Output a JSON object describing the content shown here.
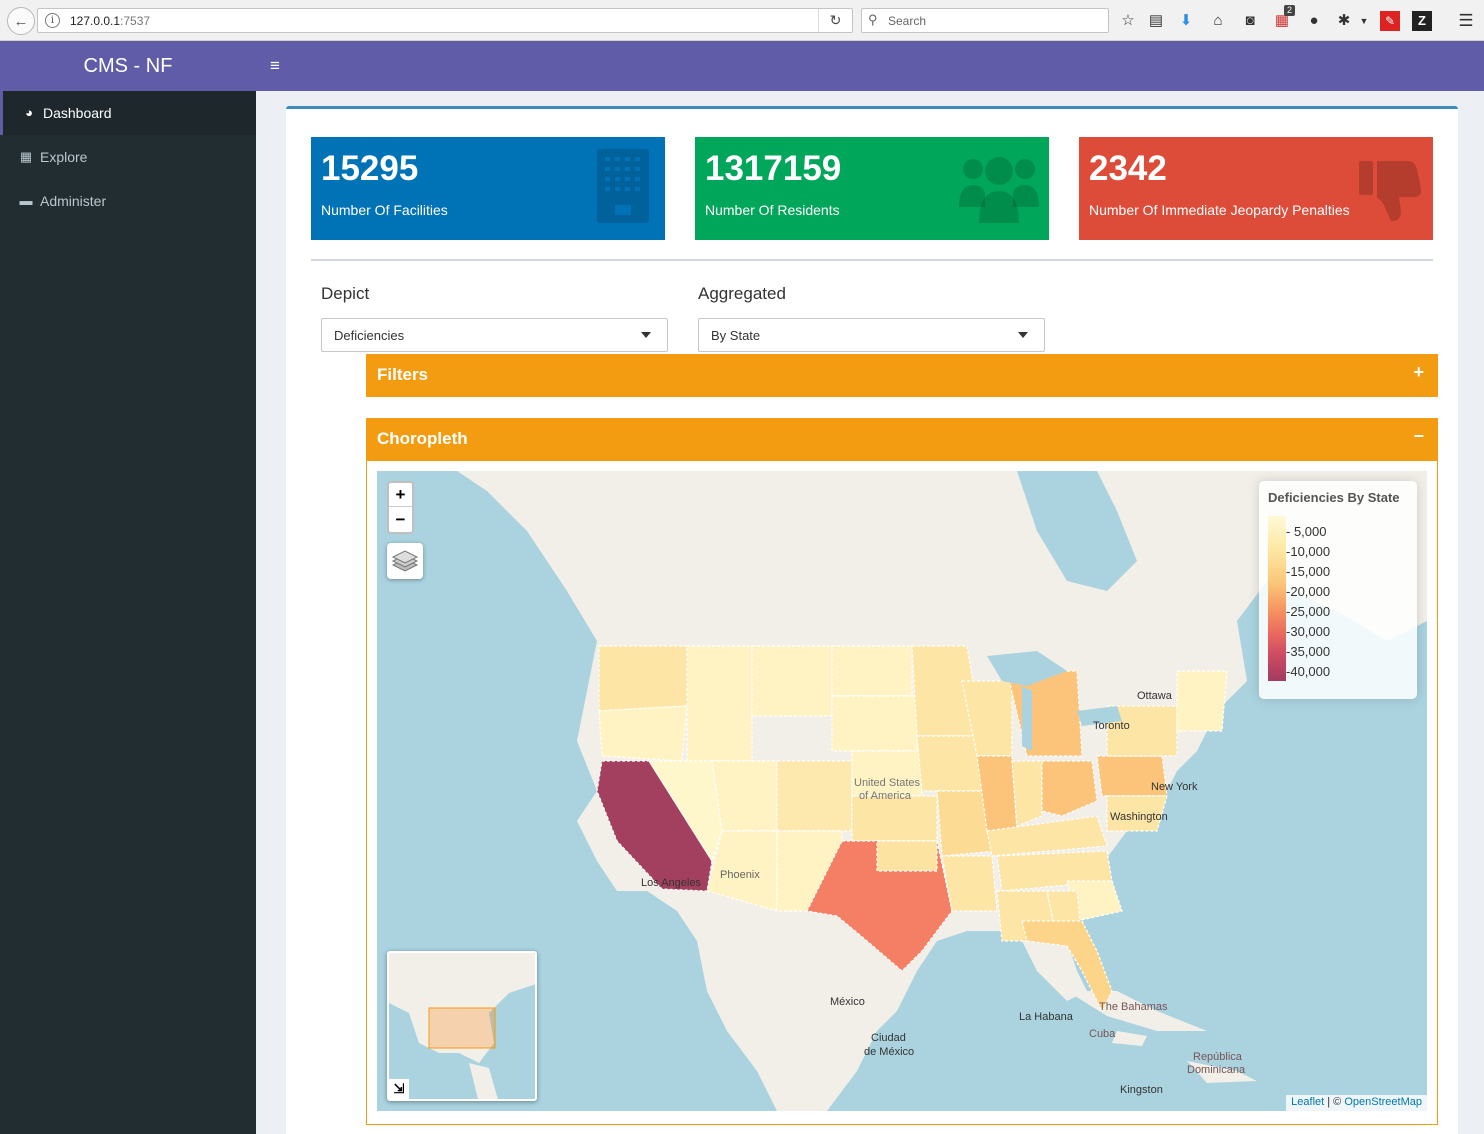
{
  "browser": {
    "url_host": "127.0.0.1",
    "url_port": ":7537",
    "search_placeholder": "Search",
    "notification_badge": "2"
  },
  "app": {
    "title": "CMS - NF",
    "accent_color": "#605ca8"
  },
  "sidebar": {
    "items": [
      {
        "label": "Dashboard",
        "icon": "dashboard-icon",
        "active": true
      },
      {
        "label": "Explore",
        "icon": "table-icon",
        "active": false
      },
      {
        "label": "Administer",
        "icon": "keyboard-icon",
        "active": false
      }
    ]
  },
  "stats": [
    {
      "value": "15295",
      "label": "Number Of Facilities",
      "color": "#0073b7",
      "icon": "building-icon"
    },
    {
      "value": "1317159",
      "label": "Number Of Residents",
      "color": "#00a65a",
      "icon": "users-icon"
    },
    {
      "value": "2342",
      "label": "Number Of Immediate Jeopardy Penalties",
      "color": "#dd4b39",
      "icon": "thumbs-down-icon"
    }
  ],
  "form": {
    "depict_label": "Depict",
    "depict_value": "Deficiencies",
    "aggregated_label": "Aggregated",
    "aggregated_value": "By State"
  },
  "panels": {
    "filters_title": "Filters",
    "filters_tool": "+",
    "choropleth_title": "Choropleth",
    "choropleth_tool": "−"
  },
  "map": {
    "zoom_in": "+",
    "zoom_out": "−",
    "legend_title": "Deficiencies By State",
    "legend_ticks": [
      "5,000",
      "10,000",
      "15,000",
      "20,000",
      "25,000",
      "30,000",
      "35,000",
      "40,000"
    ],
    "cities": {
      "ottawa": "Ottawa",
      "toronto": "Toronto",
      "new_york": "New York",
      "washington": "Washington",
      "usa_1": "United States",
      "usa_2": "of America",
      "phoenix": "Phoenix",
      "los_angeles": "Los Angeles",
      "mexico": "México",
      "ciudad_1": "Ciudad",
      "ciudad_2": "de México",
      "la_habana": "La Habana",
      "bahamas": "The Bahamas",
      "cuba": "Cuba",
      "republica_1": "República",
      "republica_2": "Dominicana",
      "kingston": "Kingston"
    },
    "attribution_leaflet": "Leaflet",
    "attribution_sep": " | © ",
    "attribution_osm": "OpenStreetMap"
  }
}
